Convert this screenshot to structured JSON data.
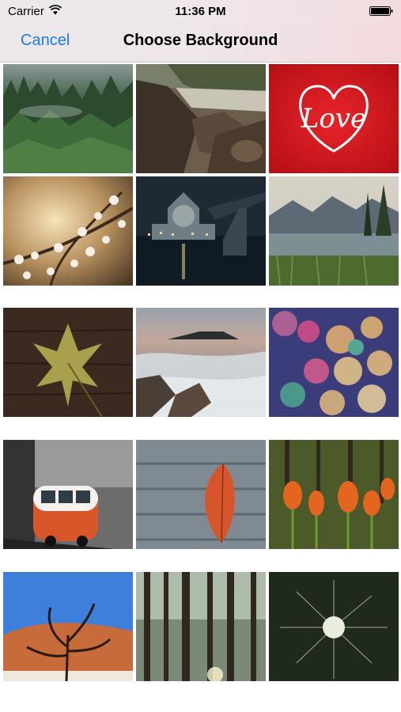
{
  "status_bar": {
    "carrier": "Carrier",
    "time": "11:36 PM",
    "wifi_icon": "wifi-icon",
    "battery_icon": "battery-icon"
  },
  "nav_bar": {
    "cancel_label": "Cancel",
    "title": "Choose Background",
    "accent_color": "#1a7cf2"
  },
  "backgrounds": [
    {
      "name": "misty-forest"
    },
    {
      "name": "rocky-river"
    },
    {
      "name": "love-heart",
      "text": "Love"
    },
    {
      "name": "cherry-blossoms"
    },
    {
      "name": "city-night-bridge"
    },
    {
      "name": "mountain-lake"
    },
    {
      "name": "leaf-on-wood"
    },
    {
      "name": "ocean-waves"
    },
    {
      "name": "bokeh-lights"
    },
    {
      "name": "vw-van"
    },
    {
      "name": "red-leaf-planks"
    },
    {
      "name": "orange-tulips"
    },
    {
      "name": "desert-tree"
    },
    {
      "name": "tall-trees"
    },
    {
      "name": "dandelion"
    }
  ]
}
